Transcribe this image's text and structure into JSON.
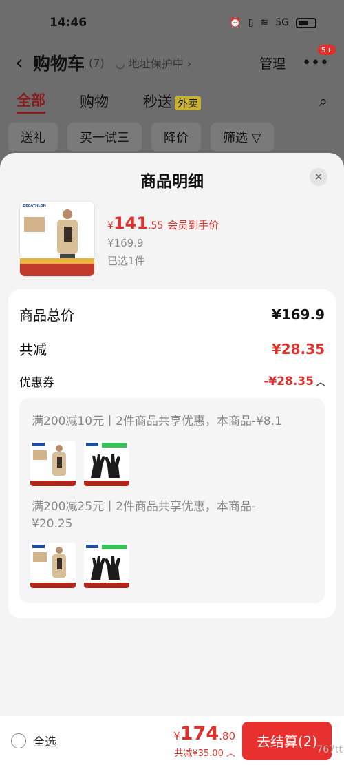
{
  "status_bar": {
    "time": "14:46",
    "battery_label": "",
    "signal_text": "5G"
  },
  "header": {
    "back_icon": "chevron-left-icon",
    "title": "购物车",
    "count": "(7)",
    "address_protect": "地址保护中",
    "manage": "管理",
    "more_badge": "5+"
  },
  "tabs": [
    {
      "label": "全部",
      "active": true
    },
    {
      "label": "购物"
    },
    {
      "label": "秒送"
    }
  ],
  "takeout_tag": "外卖",
  "filters": [
    "送礼",
    "买一试三",
    "降价",
    "筛选"
  ],
  "sheet": {
    "title": "商品明细",
    "product": {
      "brand": "DECATHLON",
      "price_symbol": "¥",
      "price_int": "141",
      "price_dec": ".55",
      "price_tag": "会员到手价",
      "original_price": "¥169.9",
      "selected": "已选1件"
    },
    "summary": {
      "total_label": "商品总价",
      "total_value": "¥169.9",
      "saving_label": "共减",
      "saving_value": "¥28.35",
      "coupon_label": "优惠券",
      "coupon_value": "-¥28.35"
    },
    "deals": [
      {
        "text": "满200减10元丨2件商品共享优惠，本商品-¥8.1"
      },
      {
        "text": "满200减25元丨2件商品共享优惠，本商品-¥20.25"
      }
    ]
  },
  "bottom_bar": {
    "select_all": "全选",
    "price_symbol": "¥",
    "price_int": "174",
    "price_dec": ".80",
    "total_saving": "共减¥35.00",
    "checkout": "去结算(2)"
  },
  "watermark": "767tt",
  "colors": {
    "accent_red": "#e0302b",
    "checkout_red": "#e8312f",
    "sheet_bg": "#f4f4f4"
  }
}
